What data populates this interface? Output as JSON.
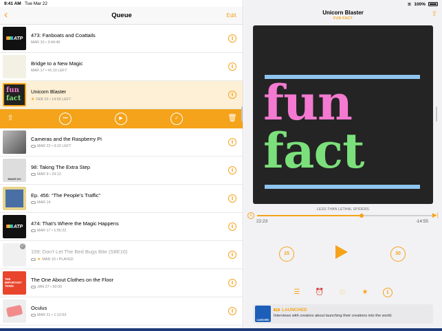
{
  "status": {
    "time": "9:41 AM",
    "date": "Tue Mar 22",
    "battery": "100%"
  },
  "nav": {
    "back_icon": "chevron-left-icon",
    "title": "Queue",
    "edit": "Edit"
  },
  "colors": {
    "accent": "#f5a31a",
    "selected_row": "#fdf0d6"
  },
  "queue": [
    {
      "art": "atp",
      "title": "473: Fanboats and Coattails",
      "meta": "MAR 10 • 3:44:46",
      "state": "normal"
    },
    {
      "art": "magic",
      "title": "Bridge to a New Magic",
      "meta": "MAR 17 • 41:10 LEFT",
      "state": "normal"
    },
    {
      "art": "fun",
      "title": "Unicorn Blaster",
      "meta": "FEB 23 • 14:55 LEFT",
      "state": "selected",
      "starred": true
    },
    {
      "art": "cam",
      "title": "Cameras and the Raspberry Pi",
      "meta": "MAR 22 • 9:22 LEFT",
      "state": "normal",
      "cloud": true
    },
    {
      "art": "98",
      "title": "98: Taking The Extra Step",
      "meta": "MAR 9 • 29:12",
      "state": "normal",
      "cloud": true,
      "art_text": "MAKE DO"
    },
    {
      "art": "456",
      "title": "Ep. 456: “The People’s Traffic”",
      "meta": "MAR 14",
      "state": "normal",
      "cloud": true
    },
    {
      "art": "atp",
      "title": "474: That’s Where the Magic Happens",
      "meta": "MAR 17 • 1:55:22",
      "state": "normal",
      "cloud": true
    },
    {
      "art": "bed",
      "title": "159: Don't Let The Bed Bugs Bite (S8E16)",
      "meta": "MAR 10 • PLAYED",
      "state": "played",
      "cloud": true,
      "starred": true
    },
    {
      "art": "clothes",
      "title": "The One About Clothes on the Floor",
      "meta": "JAN 27 • 50:00",
      "state": "normal",
      "cloud": true,
      "art_text": "THE IMPORTANT THING"
    },
    {
      "art": "oculus",
      "title": "Oculus",
      "meta": "MAR 21 • 1:12:53",
      "state": "normal",
      "cloud": true
    }
  ],
  "actions": [
    {
      "name": "share-action-button",
      "icon": "share-icon",
      "glyph": "⇧"
    },
    {
      "name": "more-action-button",
      "icon": "more-icon",
      "glyph": "•••"
    },
    {
      "name": "play-action-button",
      "icon": "play-circle-icon",
      "glyph": "▶"
    },
    {
      "name": "mark-played-button",
      "icon": "checkmark-icon",
      "glyph": "✓"
    },
    {
      "name": "delete-action-button",
      "icon": "trash-icon",
      "glyph": "🗑"
    }
  ],
  "now_playing": {
    "title": "Unicorn Blaster",
    "podcast": "FUN FACT",
    "art_words": [
      "fun",
      "fact"
    ],
    "chapter": "LESS THAN LETHAL SPIDERS",
    "elapsed": "22:23",
    "remaining": "-14:55",
    "progress": 0.6,
    "skip_back": "15",
    "skip_forward": "30"
  },
  "promo": {
    "badge": "AD",
    "name": "LAUNCHED",
    "description": "Interviews with creators about launching their creations into the world.",
    "logo_text": "LAUNCHED"
  }
}
